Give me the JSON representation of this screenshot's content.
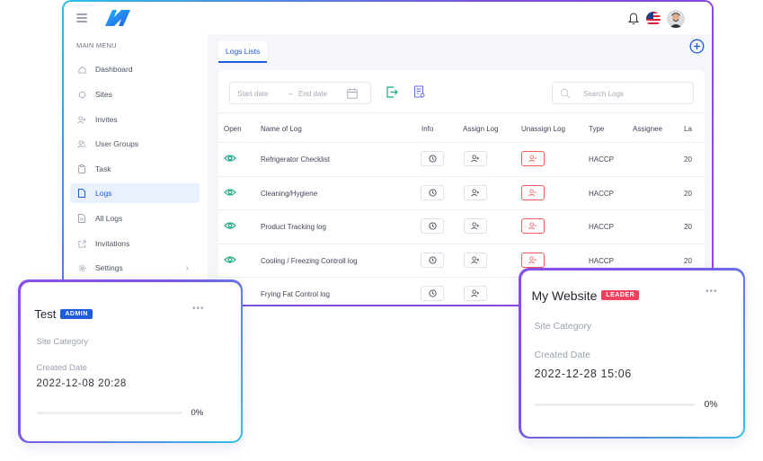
{
  "menu": {
    "title": "MAIN MENU",
    "items": [
      {
        "label": "Dashboard",
        "icon": "home-icon",
        "active": false
      },
      {
        "label": "Sites",
        "icon": "target-icon",
        "active": false
      },
      {
        "label": "Invites",
        "icon": "user-plus-icon",
        "active": false
      },
      {
        "label": "User Groups",
        "icon": "users-icon",
        "active": false
      },
      {
        "label": "Task",
        "icon": "clipboard-icon",
        "active": false
      },
      {
        "label": "Logs",
        "icon": "file-icon",
        "active": true
      },
      {
        "label": "All Logs",
        "icon": "document-icon",
        "active": false
      },
      {
        "label": "Invitations",
        "icon": "share-icon",
        "active": false
      },
      {
        "label": "Settings",
        "icon": "gear-icon",
        "active": false
      }
    ]
  },
  "tab": {
    "label": "Logs Lists"
  },
  "filters": {
    "start_placeholder": "Start date",
    "arrow": "→",
    "end_placeholder": "End date",
    "search_placeholder": "Search Logs"
  },
  "table": {
    "columns": [
      "Open",
      "Name of Log",
      "Info",
      "Assign Log",
      "Unassign Log",
      "Type",
      "Assignee",
      "La"
    ],
    "rows": [
      {
        "name": "Refrigerator Checklist",
        "type": "HACCP",
        "last": "20"
      },
      {
        "name": "Cleaning/Hygiene",
        "type": "HACCP",
        "last": "20"
      },
      {
        "name": "Product Tracking log",
        "type": "HACCP",
        "last": "20"
      },
      {
        "name": "Cooling / Freezing Controll log",
        "type": "HACCP",
        "last": "20"
      },
      {
        "name": "Frying Fat Control log",
        "type": "",
        "last": ""
      }
    ]
  },
  "cards": [
    {
      "title": "Test",
      "badge": "ADMIN",
      "badge_color": "#1e5bd8",
      "site_label": "Site Category",
      "created_label": "Created Date",
      "created_value": "2022-12-08 20:28",
      "progress_text": "0%",
      "progress": 0
    },
    {
      "title": "My Website",
      "badge": "LEADER",
      "badge_color": "#f0415e",
      "site_label": "Site Category",
      "created_label": "Created Date",
      "created_value": "2022-12-28 15:06",
      "progress_text": "0%",
      "progress": 0
    }
  ],
  "colors": {
    "accent": "#1e5bd8",
    "eye": "#1aa886",
    "danger": "#ef5a5a"
  }
}
